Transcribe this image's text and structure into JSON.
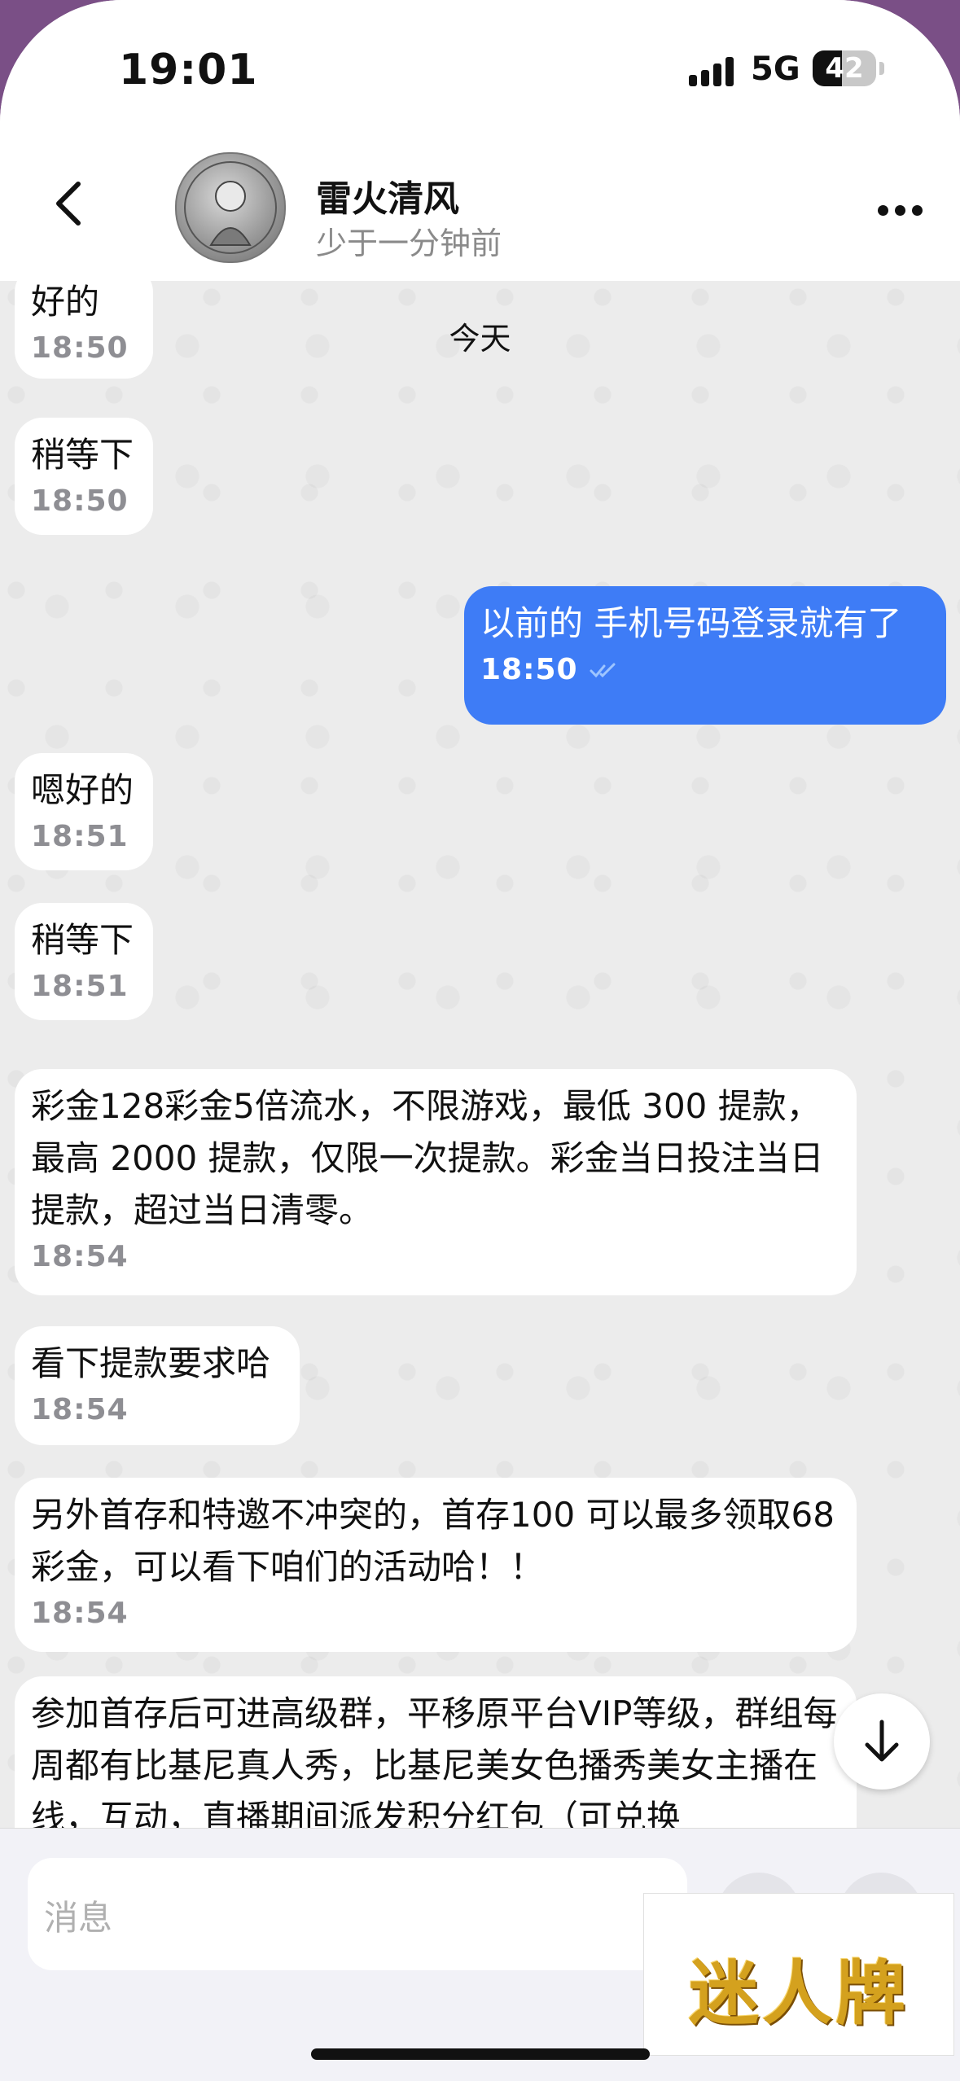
{
  "status": {
    "time": "19:01",
    "network": "5G",
    "battery": "42"
  },
  "header": {
    "name": "雷火清风",
    "last_seen": "少于一分钟前"
  },
  "chat": {
    "date_label": "今天",
    "messages": [
      {
        "direction": "in",
        "text": "好的",
        "time": "18:50"
      },
      {
        "direction": "in",
        "text": "稍等下",
        "time": "18:50"
      },
      {
        "direction": "out",
        "text": "以前的 手机号码登录就有了",
        "time": "18:50",
        "read": true
      },
      {
        "direction": "in",
        "text": "嗯好的",
        "time": "18:51"
      },
      {
        "direction": "in",
        "text": "稍等下",
        "time": "18:51"
      },
      {
        "direction": "in",
        "text": "彩金128彩金5倍流水，不限游戏，最低 300 提款，最高 2000 提款，仅限一次提款。彩金当日投注当日提款，超过当日清零。",
        "time": "18:54"
      },
      {
        "direction": "in",
        "text": "看下提款要求哈",
        "time": "18:54"
      },
      {
        "direction": "in",
        "text": "另外首存和特邀不冲突的，首存100 可以最多领取68彩金，可以看下咱们的活动哈！！",
        "time": "18:54"
      },
      {
        "direction": "in",
        "text": "参加首存后可进高级群，平移原平台VIP等级，群组每周都有比基尼真人秀，比基尼美女色播秀美女主播在线，互动，直播期间派发积分红包（可兑换",
        "time": ""
      }
    ]
  },
  "composer": {
    "placeholder": "消息"
  },
  "watermark": {
    "text": "迷人牌"
  },
  "colors": {
    "outgoing_bubble": "#3e7cf6",
    "incoming_bubble": "#ffffff",
    "chat_background": "#ececec"
  }
}
